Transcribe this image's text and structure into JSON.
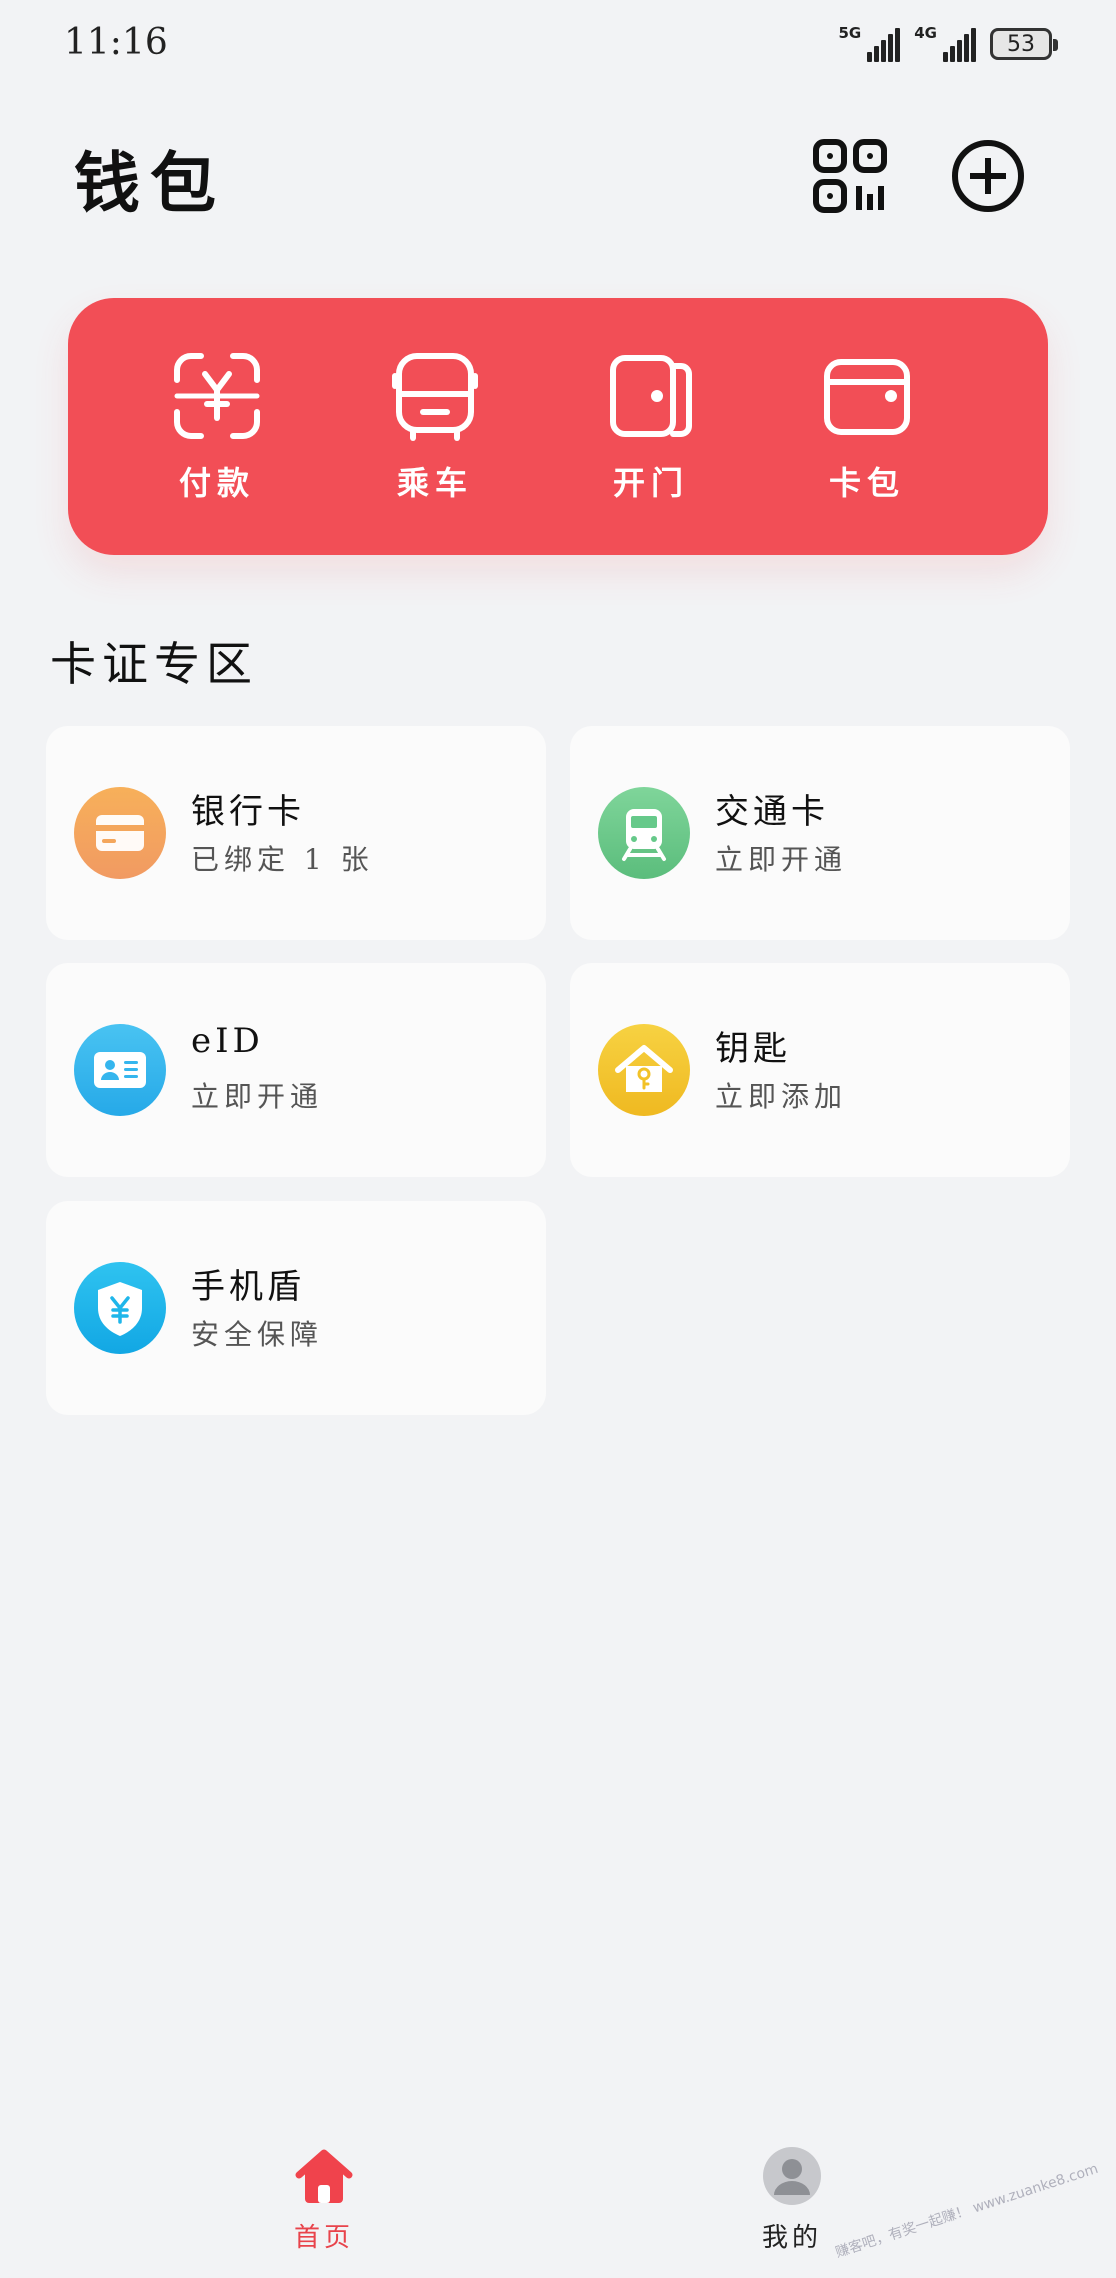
{
  "status_bar": {
    "time": "11:16",
    "network_1": "5G",
    "network_2": "4G",
    "battery": "53"
  },
  "header": {
    "title": "钱包",
    "scan_icon": "qr-scan-icon",
    "add_icon": "plus-circle-icon"
  },
  "quick_actions": [
    {
      "label": "付款",
      "icon": "yuan-scan-icon"
    },
    {
      "label": "乘车",
      "icon": "bus-icon"
    },
    {
      "label": "开门",
      "icon": "door-icon"
    },
    {
      "label": "卡包",
      "icon": "card-wallet-icon"
    }
  ],
  "colors": {
    "accent": "#f24e56",
    "nav_active": "#e8434b"
  },
  "section": {
    "title": "卡证专区"
  },
  "cards": [
    {
      "title": "银行卡",
      "subtitle": "已绑定 1 张",
      "icon": "bank-card-icon",
      "color": "#f2a45a"
    },
    {
      "title": "交通卡",
      "subtitle": "立即开通",
      "icon": "train-icon",
      "color": "#66c98a"
    },
    {
      "title": "eID",
      "subtitle": "立即开通",
      "icon": "id-card-icon",
      "color": "#35b6ee"
    },
    {
      "title": "钥匙",
      "subtitle": "立即添加",
      "icon": "house-key-icon",
      "color": "#f2c228"
    },
    {
      "title": "手机盾",
      "subtitle": "安全保障",
      "icon": "shield-yuan-icon",
      "color": "#1fb6ea"
    }
  ],
  "bottom_nav": {
    "home_label": "首页",
    "mine_label": "我的"
  },
  "watermark": "赚客吧，有奖一起赚！ www.zuanke8.com"
}
